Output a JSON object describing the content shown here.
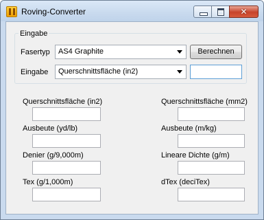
{
  "window": {
    "title": "Roving-Converter"
  },
  "input_group": {
    "legend": "Eingabe",
    "fiber_type_label": "Fasertyp",
    "fiber_type_value": "AS4 Graphite",
    "input_label": "Eingabe",
    "input_type_value": "Querschnittsfläche (in2)",
    "calculate_button": "Berechnen",
    "input_value": ""
  },
  "outputs": {
    "left": [
      {
        "label": "Querschnittsfläche (in2)",
        "value": ""
      },
      {
        "label": "Ausbeute (yd/lb)",
        "value": ""
      },
      {
        "label": "Denier (g/9,000m)",
        "value": ""
      },
      {
        "label": "Tex (g/1,000m)",
        "value": ""
      }
    ],
    "right": [
      {
        "label": "Querschnittsfläche (mm2)",
        "value": ""
      },
      {
        "label": "Ausbeute (m/kg)",
        "value": ""
      },
      {
        "label": "Lineare Dichte (g/m)",
        "value": ""
      },
      {
        "label": "dTex (deciTex)",
        "value": ""
      }
    ]
  }
}
